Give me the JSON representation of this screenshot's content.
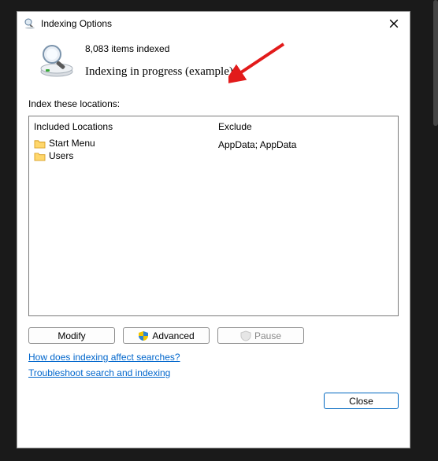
{
  "titlebar": {
    "title": "Indexing Options"
  },
  "status": {
    "count_text": "8,083 items indexed",
    "progress_text": "Indexing in progress (example)"
  },
  "section_label": "Index these locations:",
  "columns": {
    "included_header": "Included Locations",
    "exclude_header": "Exclude",
    "included": [
      {
        "label": "Start Menu"
      },
      {
        "label": "Users"
      }
    ],
    "exclude": [
      {
        "label": ""
      },
      {
        "label": "AppData; AppData"
      }
    ]
  },
  "buttons": {
    "modify": "Modify",
    "advanced": "Advanced",
    "pause": "Pause",
    "close": "Close"
  },
  "links": {
    "how": "How does indexing affect searches?",
    "troubleshoot": "Troubleshoot search and indexing"
  }
}
